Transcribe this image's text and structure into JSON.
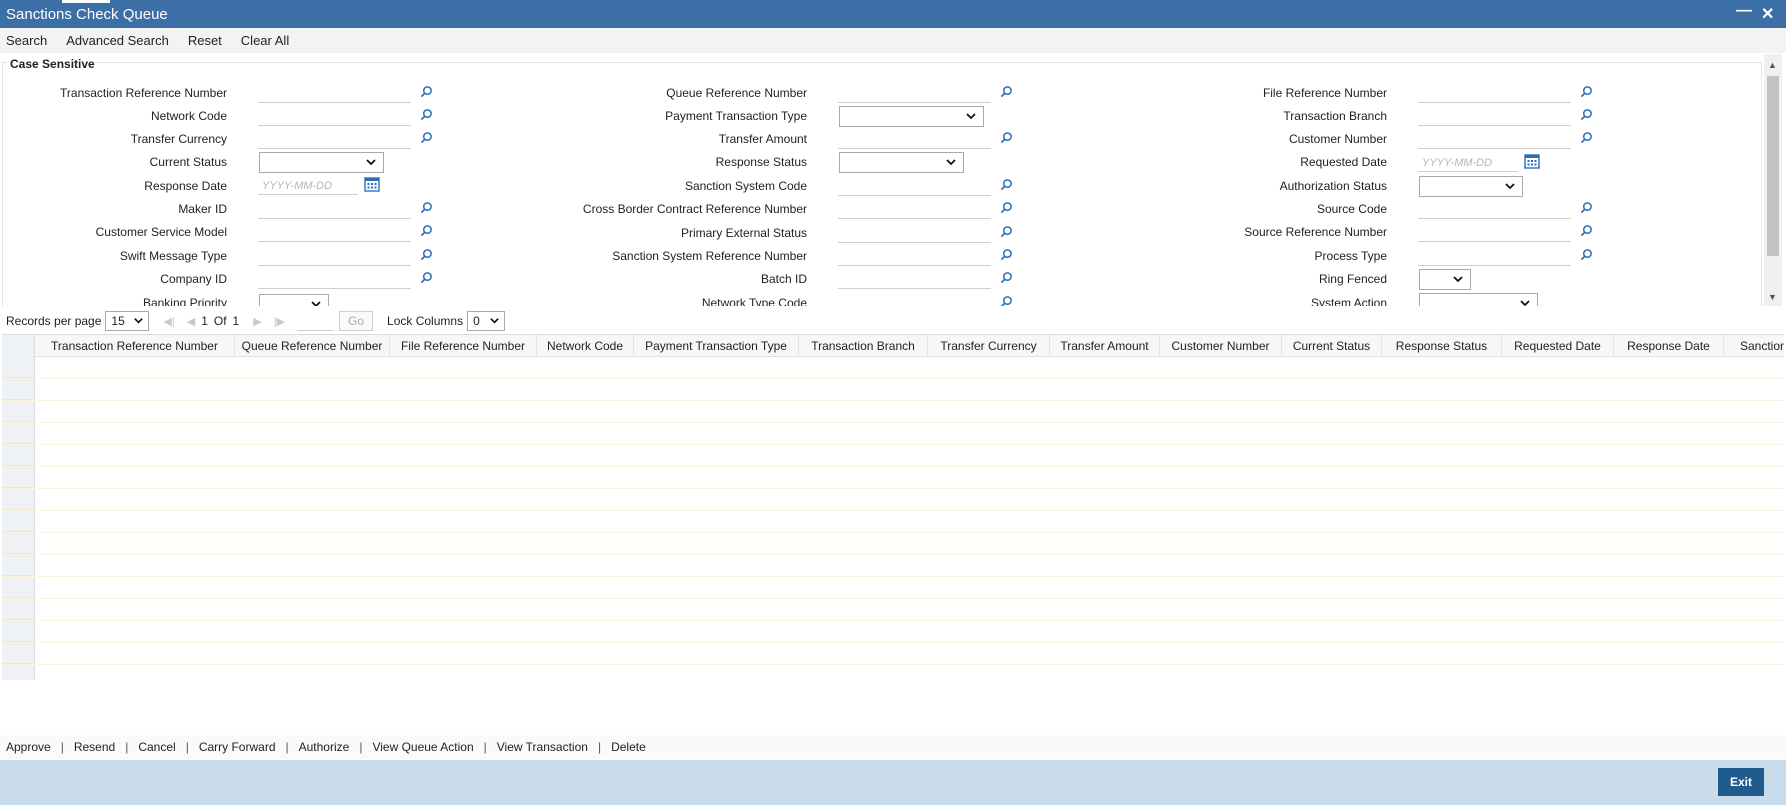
{
  "window": {
    "title": "Sanctions Check Queue"
  },
  "toolbar": {
    "search": "Search",
    "advanced_search": "Advanced Search",
    "reset": "Reset",
    "clear_all": "Clear All"
  },
  "search_panel": {
    "legend": "Case Sensitive",
    "date_placeholder": "YYYY-MM-DD",
    "col1": {
      "transaction_reference_number": "Transaction Reference Number",
      "network_code": "Network Code",
      "transfer_currency": "Transfer Currency",
      "current_status": "Current Status",
      "response_date": "Response Date",
      "maker_id": "Maker ID",
      "customer_service_model": "Customer Service Model",
      "swift_message_type": "Swift Message Type",
      "company_id": "Company ID",
      "banking_priority": "Banking Priority"
    },
    "col2": {
      "queue_reference_number": "Queue Reference Number",
      "payment_transaction_type": "Payment Transaction Type",
      "transfer_amount": "Transfer Amount",
      "response_status": "Response Status",
      "sanction_system_code": "Sanction System Code",
      "cross_border_contract_reference_number": "Cross Border Contract Reference Number",
      "primary_external_status": "Primary External Status",
      "sanction_system_reference_number": "Sanction System Reference Number",
      "batch_id": "Batch ID",
      "network_type_code": "Network Type Code"
    },
    "col3": {
      "file_reference_number": "File Reference Number",
      "transaction_branch": "Transaction Branch",
      "customer_number": "Customer Number",
      "requested_date": "Requested Date",
      "authorization_status": "Authorization Status",
      "source_code": "Source Code",
      "source_reference_number": "Source Reference Number",
      "process_type": "Process Type",
      "ring_fenced": "Ring Fenced",
      "system_action": "System Action"
    }
  },
  "pager": {
    "records_per_page_label": "Records per page",
    "records_per_page": "15",
    "current_page": "1",
    "of_label": "Of",
    "total_pages": "1",
    "go_label": "Go",
    "lock_columns_label": "Lock Columns",
    "lock_columns": "0"
  },
  "grid": {
    "columns": [
      "Transaction Reference Number",
      "Queue Reference Number",
      "File Reference Number",
      "Network Code",
      "Payment Transaction Type",
      "Transaction Branch",
      "Transfer Currency",
      "Transfer Amount",
      "Customer Number",
      "Current Status",
      "Response Status",
      "Requested Date",
      "Response Date",
      "Sanction"
    ]
  },
  "actions": {
    "approve": "Approve",
    "resend": "Resend",
    "cancel": "Cancel",
    "carry_forward": "Carry Forward",
    "authorize": "Authorize",
    "view_queue_action": "View Queue Action",
    "view_transaction": "View Transaction",
    "delete": "Delete",
    "separator": "|"
  },
  "footer": {
    "exit": "Exit"
  },
  "colors": {
    "title_bar": "#3c6fa5",
    "footer": "#c9dceb",
    "exit_button": "#1f5b8c",
    "icon": "#2a6ebb"
  }
}
